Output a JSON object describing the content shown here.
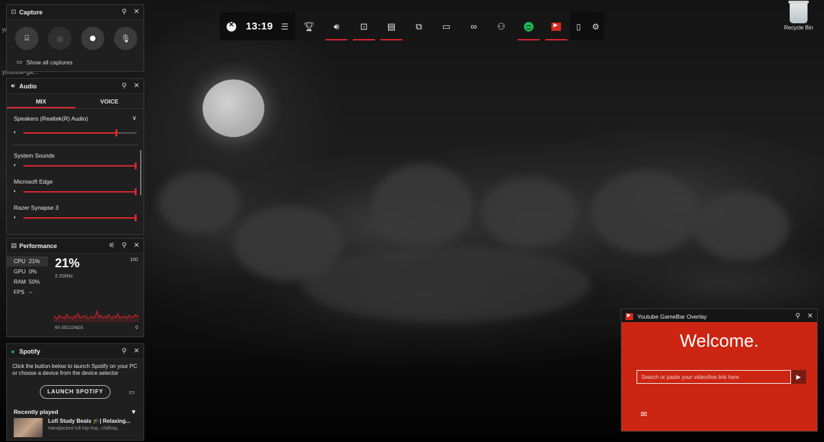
{
  "desktop": {
    "recycle_bin_label": "Recycle Bin",
    "partial_text_1": "yo",
    "partial_text_2": "youtube-ga..."
  },
  "gamebar": {
    "time": "13:19",
    "items": [
      {
        "icon": "widget-menu-icon",
        "glyph": "☰",
        "active": false
      },
      {
        "icon": "achievements-icon",
        "glyph": "🏆︎",
        "active": false
      },
      {
        "icon": "audio-icon",
        "glyph": "🔊︎",
        "active": true
      },
      {
        "icon": "capture-icon",
        "glyph": "⊡",
        "active": true
      },
      {
        "icon": "performance-icon",
        "glyph": "▤",
        "active": true
      },
      {
        "icon": "chat-icon",
        "glyph": "⧉",
        "active": false
      },
      {
        "icon": "gallery-icon",
        "glyph": "▭",
        "active": false
      },
      {
        "icon": "looking-for-group-icon",
        "glyph": "∞",
        "active": false
      },
      {
        "icon": "social-icon",
        "glyph": "⚇",
        "active": false
      },
      {
        "icon": "spotify-icon",
        "glyph": "",
        "active": true
      },
      {
        "icon": "youtube-overlay-icon",
        "glyph": "",
        "active": true
      }
    ],
    "right_items": [
      {
        "icon": "mouse-icon",
        "glyph": "▯"
      },
      {
        "icon": "settings-icon",
        "glyph": "⚙"
      }
    ],
    "accent": "#e0262d"
  },
  "capture": {
    "title": "Capture",
    "show_all": "Show all captures"
  },
  "audio": {
    "title": "Audio",
    "tabs": [
      "MIX",
      "VOICE"
    ],
    "device": "Speakers (Realtek(R) Audio)",
    "device_volume": 0.82,
    "apps": [
      {
        "name": "System Sounds",
        "volume": 1.0
      },
      {
        "name": "Microsoft Edge",
        "volume": 1.0
      },
      {
        "name": "Razer Synapse 3",
        "volume": 1.0
      }
    ]
  },
  "performance": {
    "title": "Performance",
    "metrics": [
      {
        "label": "CPU",
        "value": "21%"
      },
      {
        "label": "GPU",
        "value": "0%"
      },
      {
        "label": "RAM",
        "value": "50%"
      },
      {
        "label": "FPS",
        "value": "--"
      }
    ],
    "big_value": "21%",
    "frequency": "2.200Hz",
    "max_label": "100",
    "time_label": "60 SECONDS",
    "min_label": "0",
    "cpu_history": [
      12,
      18,
      9,
      22,
      14,
      16,
      11,
      25,
      13,
      17,
      10,
      20,
      15,
      28,
      12,
      18,
      16,
      22,
      11,
      14,
      19,
      13,
      17,
      35,
      15,
      22,
      12,
      18,
      14,
      24,
      16,
      11,
      20,
      14,
      27,
      13,
      17,
      15,
      19,
      12,
      22,
      16,
      14,
      24,
      18,
      20
    ]
  },
  "spotify": {
    "title": "Spotify",
    "description": "Click the button below to launch Spotify on your PC or choose a device from the device selector",
    "launch_label": "LAUNCH SPOTIFY",
    "recently_played": "Recently played",
    "track_title": "Lofi Study Beats 🎓| Relaxing...",
    "track_subtitle": "Handpicked lofi hip-hop, chillhop,"
  },
  "youtube": {
    "title": "Youtube GameBar Overlay",
    "welcome": "Welcome.",
    "input_placeholder": "Search or paste your video/live link here",
    "brand_color": "#cc2512"
  }
}
